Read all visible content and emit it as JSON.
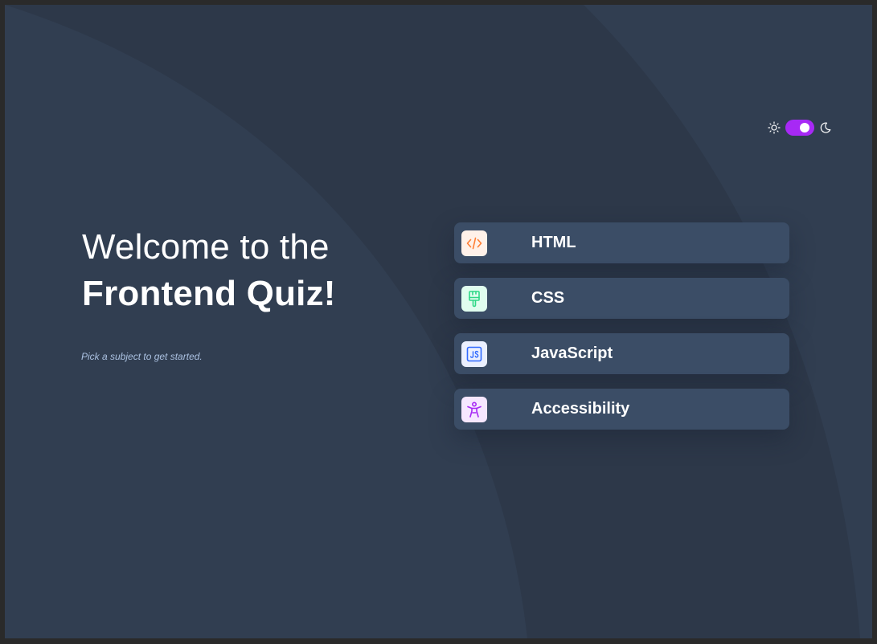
{
  "theme_toggle": {
    "light_icon": "sun-icon",
    "dark_icon": "moon-icon",
    "state": "dark",
    "accent": "#a729f5"
  },
  "welcome": {
    "line1": "Welcome to the",
    "line2": "Frontend Quiz!"
  },
  "subtitle": "Pick a subject to get started.",
  "subjects": [
    {
      "label": "HTML",
      "icon": "code-icon",
      "icon_color": "#ff7e35",
      "badge_bg": "#fff1e9"
    },
    {
      "label": "CSS",
      "icon": "paintbrush-icon",
      "icon_color": "#2fd887",
      "badge_bg": "#e0fdef"
    },
    {
      "label": "JavaScript",
      "icon": "js-icon",
      "icon_color": "#306aff",
      "badge_bg": "#ebf0ff"
    },
    {
      "label": "Accessibility",
      "icon": "accessibility-icon",
      "icon_color": "#a729f5",
      "badge_bg": "#f6e7ff"
    }
  ],
  "colors": {
    "background": "#313e51",
    "card": "#3b4d66",
    "text": "#ffffff",
    "muted": "#abc1e1"
  }
}
